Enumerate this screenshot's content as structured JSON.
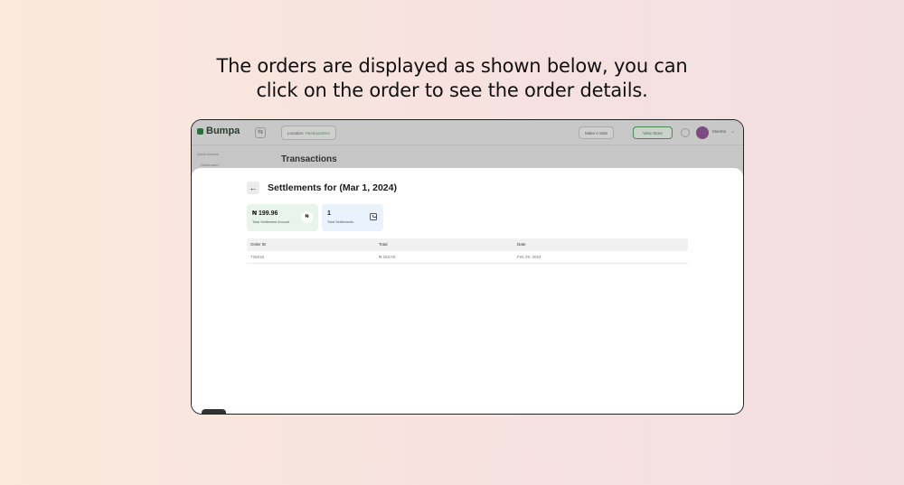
{
  "caption": {
    "line1": "The orders are displayed as shown below, you can",
    "line2": "click on the order to see the order details."
  },
  "app": {
    "brand": "Bumpa",
    "location_label": "Location:",
    "location_value": "Headquarters",
    "make_sale_label": "Make A Sale",
    "view_store_label": "View Store",
    "user_name": "Moretto",
    "sidebar_section": "Quick Access",
    "sidebar_item": "Dashboard",
    "page_title": "Transactions"
  },
  "modal": {
    "title": "Settlements for (Mar 1, 2024)",
    "summary": {
      "amount_value": "₦ 199.96",
      "amount_label": "Total Settlement Amount",
      "amount_icon_text": "₦",
      "count_value": "1",
      "count_label": "Total Settlements"
    },
    "table": {
      "headers": [
        "Order ID",
        "Total",
        "Date"
      ],
      "rows": [
        [
          "725619",
          "₦ 203.00",
          "Feb 29, 2024"
        ]
      ]
    }
  },
  "colors": {
    "brand_green": "#2b6e3a",
    "amount_card_bg": "#eaf4ee",
    "count_card_bg": "#eaf3fb"
  },
  "icons": {
    "back": "arrow-left-icon",
    "menu": "menu-icon",
    "bag": "shopping-bag-icon",
    "naira": "naira-icon"
  }
}
